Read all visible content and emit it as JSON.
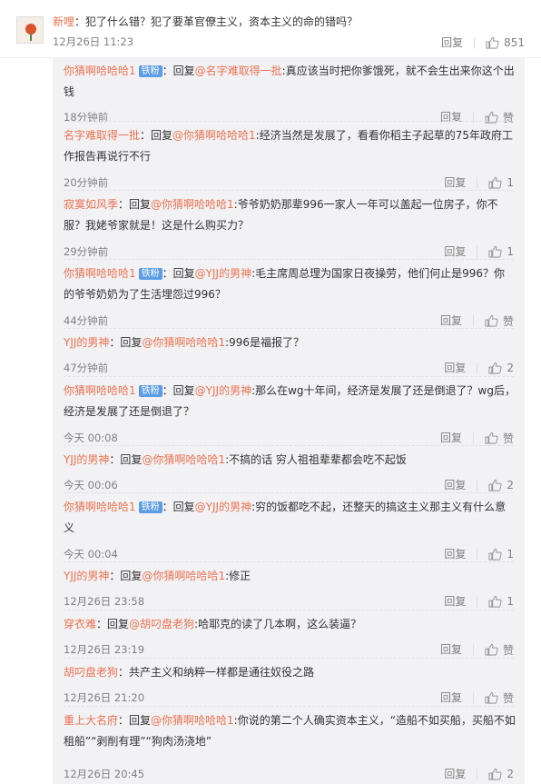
{
  "main": {
    "name": "新哩",
    "text": "：犯了什么错？犯了要革官僚主义，资本主义的命的错吗？",
    "time": "12月26日 11:23",
    "reply": "回复",
    "likes": "851"
  },
  "replies": [
    {
      "name": "你猜啊哈哈哈1",
      "badge": "铁粉",
      "prefix": "：回复",
      "target": "@名字难取得一批",
      "text": ":真应该当时把你爹饿死，就不会生出来你这个出钱",
      "time": "18分钟前",
      "reply": "回复",
      "likes": "赞"
    },
    {
      "name": "名字难取得一批",
      "badge": "",
      "prefix": "：回复",
      "target": "@你猜啊哈哈哈1",
      "text": ":经济当然是发展了，看看你稻主子起草的75年政府工作报告再说行不行",
      "time": "20分钟前",
      "reply": "回复",
      "likes": "1"
    },
    {
      "name": "寂寞如风季",
      "badge": "",
      "prefix": "：回复",
      "target": "@你猜啊哈哈哈1",
      "text": ":爷爷奶奶那辈996一家人一年可以盖起一位房子，你不服？我姥爷家就是！这是什么购买力？",
      "time": "29分钟前",
      "reply": "回复",
      "likes": "1"
    },
    {
      "name": "你猜啊哈哈哈1",
      "badge": "铁粉",
      "prefix": "：回复",
      "target": "@YJJ的男神",
      "text": ":毛主席周总理为国家日夜操劳，他们何止是996？你的爷爷奶奶为了生活埋怨过996？",
      "time": "44分钟前",
      "reply": "回复",
      "likes": "赞"
    },
    {
      "name": "YJJ的男神",
      "badge": "",
      "prefix": "：回复",
      "target": "@你猜啊哈哈哈1",
      "text": ":996是福报了？",
      "time": "47分钟前",
      "reply": "回复",
      "likes": "2"
    },
    {
      "name": "你猜啊哈哈哈1",
      "badge": "铁粉",
      "prefix": "：回复",
      "target": "@YJJ的男神",
      "text": ":那么在wg十年间，经济是发展了还是倒退了？wg后，经济是发展了还是倒退了？",
      "time": "今天 00:08",
      "reply": "回复",
      "likes": "赞"
    },
    {
      "name": "YJJ的男神",
      "badge": "",
      "prefix": "：回复",
      "target": "@你猜啊哈哈哈1",
      "text": ":不搞的话 穷人祖祖辈辈都会吃不起饭",
      "time": "今天 00:06",
      "reply": "回复",
      "likes": "2"
    },
    {
      "name": "你猜啊哈哈哈1",
      "badge": "铁粉",
      "prefix": "：回复",
      "target": "@YJJ的男神",
      "text": ":穷的饭都吃不起，还整天的搞这主义那主义有什么意义",
      "time": "今天 00:04",
      "reply": "回复",
      "likes": "1"
    },
    {
      "name": "YJJ的男神",
      "badge": "",
      "prefix": "：回复",
      "target": "@你猜啊哈哈哈1",
      "text": ":修正",
      "time": "12月26日 23:58",
      "reply": "回复",
      "likes": "1"
    },
    {
      "name": "穿衣难",
      "badge": "",
      "prefix": "：回复",
      "target": "@胡叼盘老狗",
      "text": ":哈耶克的读了几本啊，这么装逼？",
      "time": "12月26日 23:19",
      "reply": "回复",
      "likes": "赞"
    },
    {
      "name": "胡叼盘老狗",
      "badge": "",
      "prefix": "",
      "target": "",
      "text": "：共产主义和纳粹一样都是通往奴役之路",
      "time": "12月26日 21:20",
      "reply": "回复",
      "likes": "赞"
    },
    {
      "name": "重上大名府",
      "badge": "",
      "prefix": "：回复",
      "target": "@你猜啊哈哈哈1",
      "text": ":你说的第二个人确实资本主义，“造船不如买船，买船不如租船”“剥削有理”“狗肉汤浇地”",
      "time": "12月26日 20:45",
      "reply": "回复",
      "likes": "2"
    }
  ],
  "colors": {
    "name": "#eb7350",
    "badge": "#5c9de6",
    "panel": "#f2f2f5",
    "meta": "#808080"
  }
}
